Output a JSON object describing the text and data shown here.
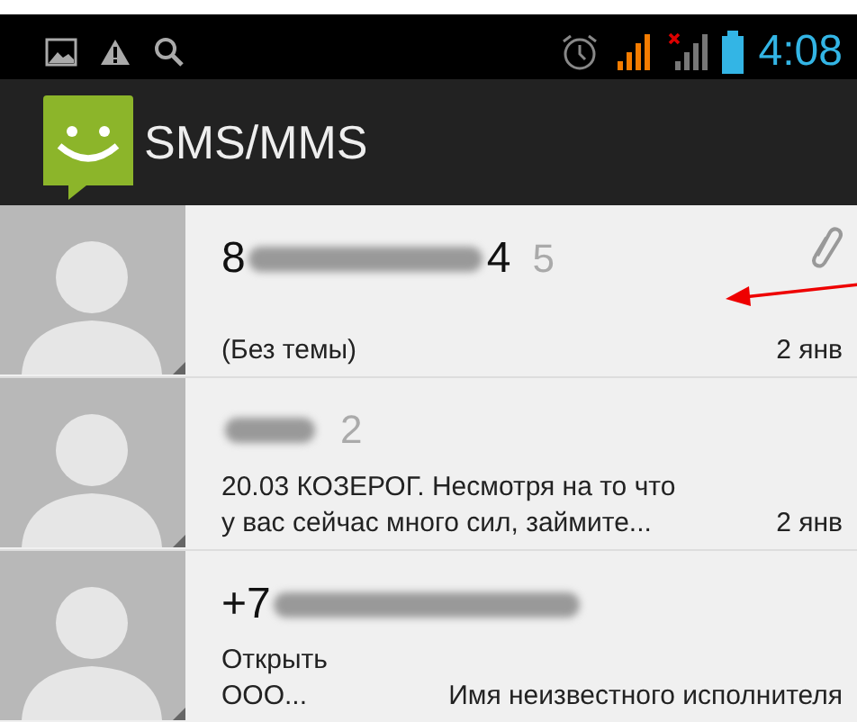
{
  "status_bar": {
    "time": "4:08"
  },
  "action_bar": {
    "title": "SMS/MMS"
  },
  "conversations": [
    {
      "name_parts": [
        {
          "kind": "text",
          "text": "8"
        },
        {
          "kind": "redacted"
        },
        {
          "kind": "text",
          "text": "4"
        }
      ],
      "count": "5",
      "attachment": true,
      "snippet_lines": [
        "(Без темы)"
      ],
      "meta": "2 янв"
    },
    {
      "name_parts": [
        {
          "kind": "redacted"
        }
      ],
      "count": "2",
      "attachment": false,
      "snippet_lines": [
        "20.03 КОЗЕРОГ. Несмотря на то что",
        "у вас сейчас много сил, займите..."
      ],
      "meta": "2 янв"
    },
    {
      "name_parts": [
        {
          "kind": "text",
          "text": "+7"
        },
        {
          "kind": "redacted"
        }
      ],
      "attachment": false,
      "snippet_lines": [
        "Открыть",
        "ООО..."
      ],
      "meta": "Имя неизвестного исполнителя"
    }
  ]
}
